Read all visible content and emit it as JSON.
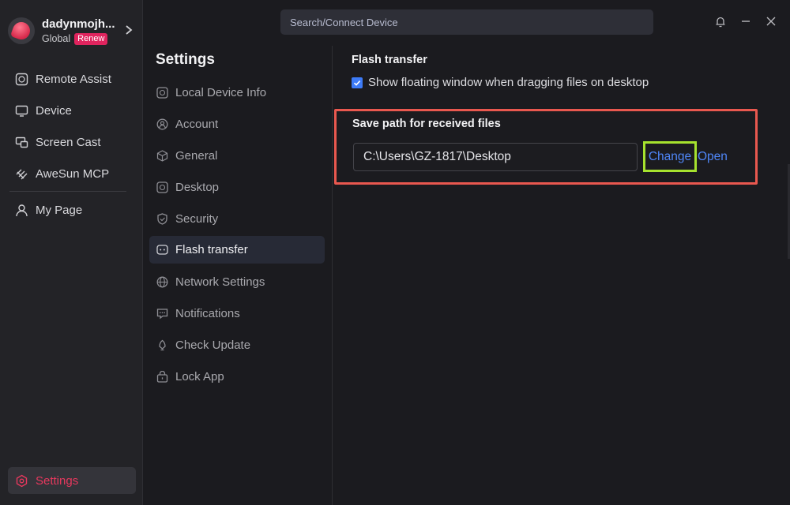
{
  "profile": {
    "username": "dadynmojh...",
    "region": "Global",
    "badge": "Renew"
  },
  "nav": {
    "items": [
      {
        "label": "Remote Assist",
        "icon": "remote-assist-icon"
      },
      {
        "label": "Device",
        "icon": "monitor-icon"
      },
      {
        "label": "Screen Cast",
        "icon": "screen-cast-icon"
      },
      {
        "label": "AweSun MCP",
        "icon": "mcp-icon"
      },
      {
        "label": "My Page",
        "icon": "user-icon"
      }
    ],
    "settings_label": "Settings"
  },
  "topbar": {
    "search_placeholder": "Search/Connect Device"
  },
  "settings": {
    "title": "Settings",
    "items": [
      {
        "label": "Local Device Info",
        "icon": "device-info-icon"
      },
      {
        "label": "Account",
        "icon": "account-icon"
      },
      {
        "label": "General",
        "icon": "cube-icon"
      },
      {
        "label": "Desktop",
        "icon": "desktop-icon"
      },
      {
        "label": "Security",
        "icon": "shield-icon"
      },
      {
        "label": "Flash transfer",
        "icon": "flash-transfer-icon"
      },
      {
        "label": "Network Settings",
        "icon": "globe-icon"
      },
      {
        "label": "Notifications",
        "icon": "message-icon"
      },
      {
        "label": "Check Update",
        "icon": "update-icon"
      },
      {
        "label": "Lock App",
        "icon": "lock-icon"
      }
    ],
    "active_index": 5
  },
  "content": {
    "section_title": "Flash transfer",
    "checkbox_label": "Show floating window when dragging files on desktop",
    "checkbox_checked": true,
    "save_title": "Save path for received files",
    "save_path": "C:\\Users\\GZ-1817\\Desktop",
    "change_label": "Change",
    "open_label": "Open"
  },
  "colors": {
    "accent": "#e8385e",
    "link": "#4f86f7",
    "checkbox": "#3d7bf7",
    "highlight_red": "#e9584f",
    "highlight_green": "#a6e22e"
  }
}
